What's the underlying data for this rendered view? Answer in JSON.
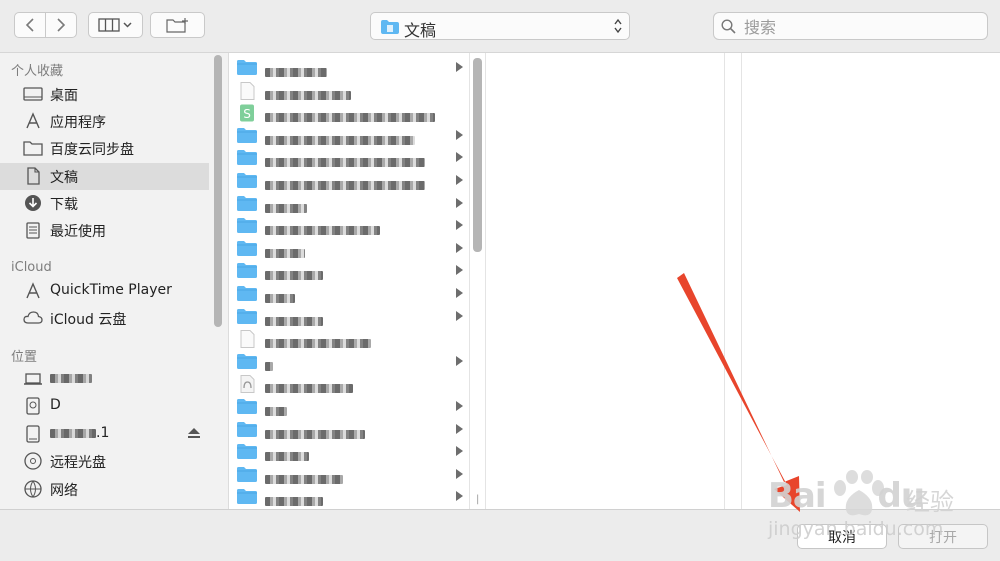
{
  "toolbar": {
    "location": "文稿",
    "search_placeholder": "搜索"
  },
  "sidebar": {
    "sections": [
      {
        "heading": "个人收藏",
        "items": [
          {
            "label": "桌面",
            "icon": "desktop-icon"
          },
          {
            "label": "应用程序",
            "icon": "applications-icon"
          },
          {
            "label": "百度云同步盘",
            "icon": "folder-icon"
          },
          {
            "label": "文稿",
            "icon": "documents-icon",
            "selected": true
          },
          {
            "label": "下载",
            "icon": "downloads-icon"
          },
          {
            "label": "最近使用",
            "icon": "recents-icon"
          }
        ]
      },
      {
        "heading": "iCloud",
        "items": [
          {
            "label": "QuickTime Player",
            "icon": "applications-icon"
          },
          {
            "label": "iCloud 云盘",
            "icon": "cloud-icon"
          }
        ]
      },
      {
        "heading": "位置",
        "items": [
          {
            "label": "",
            "icon": "laptop-icon"
          },
          {
            "label": "D",
            "icon": "disk-icon"
          },
          {
            "label": ".1",
            "icon": "external-drive-icon"
          },
          {
            "label": "远程光盘",
            "icon": "optical-disc-icon"
          },
          {
            "label": "网络",
            "icon": "network-icon"
          }
        ]
      }
    ]
  },
  "files": [
    {
      "type": "folder",
      "name": "",
      "arrow": true
    },
    {
      "type": "doc",
      "name": "",
      "arrow": false
    },
    {
      "type": "sheet",
      "name": "",
      "arrow": false
    },
    {
      "type": "folder",
      "name": "",
      "arrow": true
    },
    {
      "type": "folder",
      "name": "",
      "arrow": true
    },
    {
      "type": "folder",
      "name": "",
      "arrow": true
    },
    {
      "type": "folder",
      "name": "",
      "arrow": true
    },
    {
      "type": "folder",
      "name": "",
      "arrow": true
    },
    {
      "type": "folder",
      "name": "",
      "arrow": true
    },
    {
      "type": "folder",
      "name": "",
      "arrow": true
    },
    {
      "type": "folder",
      "name": "",
      "arrow": true
    },
    {
      "type": "folder",
      "name": "",
      "arrow": true
    },
    {
      "type": "doc",
      "name": "",
      "arrow": false
    },
    {
      "type": "folder",
      "name": "",
      "arrow": true
    },
    {
      "type": "image",
      "name": "",
      "arrow": false
    },
    {
      "type": "folder",
      "name": "",
      "arrow": true
    },
    {
      "type": "folder",
      "name": "",
      "arrow": true
    },
    {
      "type": "folder",
      "name": "",
      "arrow": true
    },
    {
      "type": "folder",
      "name": "",
      "arrow": true
    },
    {
      "type": "folder",
      "name": "",
      "arrow": true
    }
  ],
  "footer": {
    "cancel_label": "取消",
    "open_label": "打开"
  },
  "watermark": {
    "brand": "经验",
    "url": "jingyan.baidu.com"
  },
  "colors": {
    "folder_blue": "#5fb8f2",
    "annotation_red": "#e8452c",
    "selected_row": "#dcdcdc"
  }
}
